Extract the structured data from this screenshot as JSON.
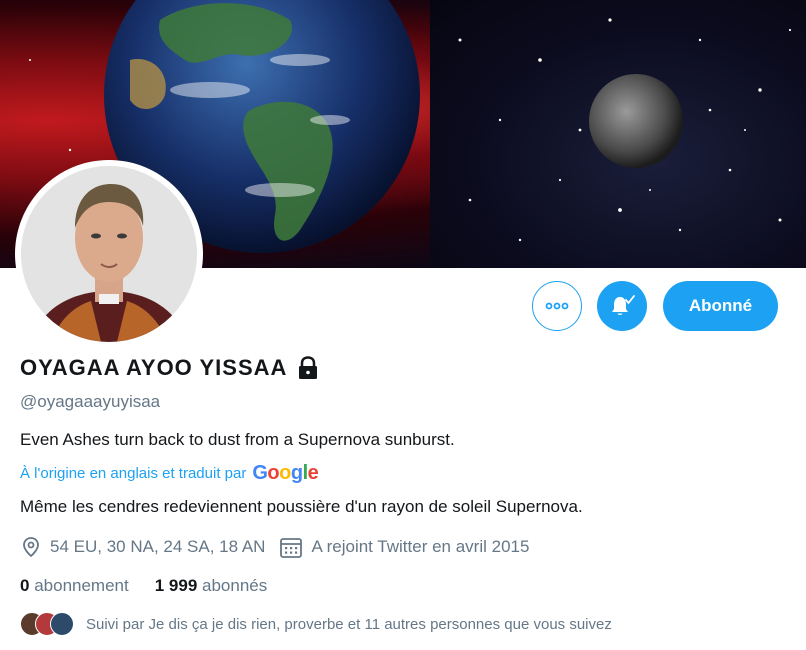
{
  "profile": {
    "name": "OYAGAA AYOO YISSAA",
    "handle": "@oyagaaayuyisaa",
    "bio": "Even Ashes turn back to dust from a Supernova sunburst.",
    "translation_note": "À l'origine en anglais et traduit par",
    "translation_provider": "Google",
    "bio_translated": "Même les cendres redeviennent poussière d'un rayon de soleil Supernova.",
    "location": "54 EU, 30 NA, 24 SA, 18 AN",
    "joined": "A rejoint Twitter en avril 2015",
    "following_count": "0",
    "following_label": "abonnement",
    "followers_count": "1 999",
    "followers_label": "abonnés",
    "followed_by": "Suivi par Je dis ça je dis rien, proverbe et 11 autres personnes que vous suivez"
  },
  "actions": {
    "follow_label": "Abonné",
    "more_icon": "more-icon",
    "bell_icon": "bell-icon"
  },
  "colors": {
    "accent": "#1da1f2",
    "text": "#14171a",
    "muted": "#657786"
  }
}
